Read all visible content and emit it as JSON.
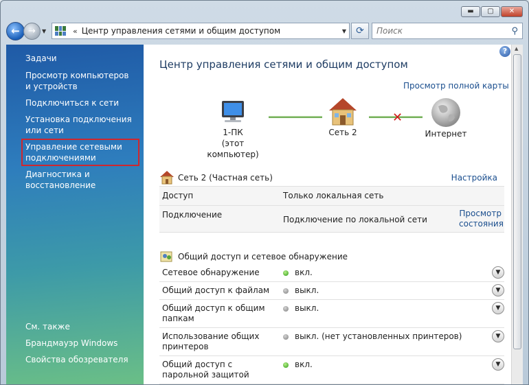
{
  "window": {
    "minimize": "▬",
    "maximize": "▢",
    "close": "✕"
  },
  "nav": {
    "path_separator": "«",
    "path": "Центр управления сетями и общим доступом",
    "search_placeholder": "Поиск"
  },
  "sidebar": {
    "tasks_heading": "Задачи",
    "items": [
      "Просмотр компьютеров и устройств",
      "Подключиться к сети",
      "Установка подключения или сети",
      "Управление сетевыми подключениями",
      "Диагностика и восстановление"
    ],
    "see_also_heading": "См. также",
    "see_also": [
      "Брандмауэр Windows",
      "Свойства обозревателя"
    ]
  },
  "main": {
    "title": "Центр управления сетями и общим доступом",
    "full_map_link": "Просмотр полной карты",
    "map": {
      "computer_name": "1-ПК",
      "computer_sub": "(этот компьютер)",
      "network": "Сеть 2",
      "internet": "Интернет"
    },
    "network": {
      "name": "Сеть 2 (Частная сеть)",
      "customize_link": "Настройка",
      "rows": [
        {
          "key": "Доступ",
          "value": "Только локальная сеть"
        },
        {
          "key": "Подключение",
          "value": "Подключение по локальной сети",
          "action": "Просмотр состояния"
        }
      ]
    },
    "sharing": {
      "heading": "Общий доступ и сетевое обнаружение",
      "rows": [
        {
          "key": "Сетевое обнаружение",
          "value": "вкл.",
          "state": "on"
        },
        {
          "key": "Общий доступ к файлам",
          "value": "выкл.",
          "state": "off"
        },
        {
          "key": "Общий доступ к общим папкам",
          "value": "выкл.",
          "state": "off"
        },
        {
          "key": "Использование общих принтеров",
          "value": "выкл. (нет установленных принтеров)",
          "state": "off"
        },
        {
          "key": "Общий доступ с парольной защитой",
          "value": "вкл.",
          "state": "on"
        }
      ]
    }
  },
  "icons": [
    "back-arrow-icon",
    "forward-arrow-icon",
    "network-folder-icon",
    "refresh-icon",
    "search-icon",
    "help-icon",
    "computer-icon",
    "house-icon",
    "globe-icon",
    "disconnected-x-icon",
    "sharing-icon",
    "status-dot-icon",
    "expand-chevron-icon"
  ],
  "colors": {
    "link": "#1a4e8e",
    "status_on": "#2f9a16",
    "status_off": "#7e7e7e",
    "highlight_box": "#d0262d"
  }
}
